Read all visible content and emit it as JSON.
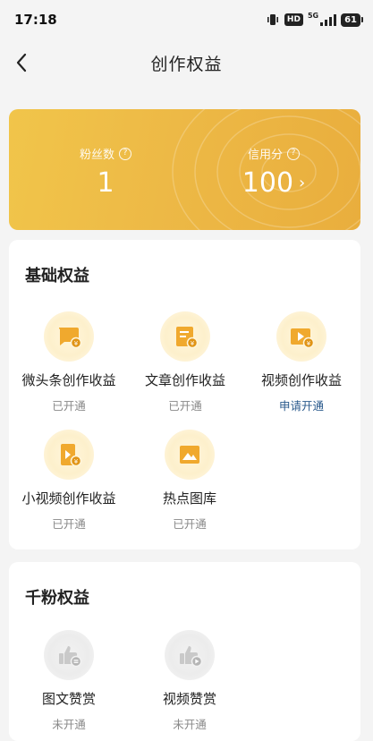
{
  "status_bar": {
    "time": "17:18",
    "hd": "HD",
    "network": "5G",
    "battery": "61"
  },
  "nav": {
    "title": "创作权益",
    "back_icon": "chevron-left-icon"
  },
  "stats": {
    "fans": {
      "label": "粉丝数",
      "value": "1"
    },
    "credit": {
      "label": "信用分",
      "value": "100"
    }
  },
  "sections": {
    "basic": {
      "title": "基础权益",
      "items": [
        {
          "label": "微头条创作收益",
          "status": "已开通",
          "icon": "micro-post-icon"
        },
        {
          "label": "文章创作收益",
          "status": "已开通",
          "icon": "article-icon"
        },
        {
          "label": "视频创作收益",
          "status": "申请开通",
          "icon": "video-icon"
        },
        {
          "label": "小视频创作收益",
          "status": "已开通",
          "icon": "short-video-icon"
        },
        {
          "label": "热点图库",
          "status": "已开通",
          "icon": "image-library-icon"
        }
      ]
    },
    "thousand_fans": {
      "title": "千粉权益",
      "items": [
        {
          "label": "图文赞赏",
          "status": "未开通",
          "icon": "thumbs-up-icon"
        },
        {
          "label": "视频赞赏",
          "status": "未开通",
          "icon": "thumbs-up-play-icon"
        }
      ]
    }
  },
  "colors": {
    "accent_gold": "#edb946",
    "icon_orange": "#f0a92e",
    "link_blue": "#2a5a8c",
    "muted_text": "#888888"
  }
}
